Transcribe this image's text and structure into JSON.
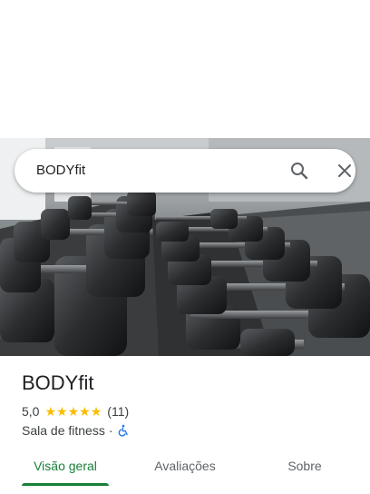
{
  "search": {
    "query": "BODYfit"
  },
  "place": {
    "name": "BODYfit",
    "rating": "5,0",
    "review_count": "(11)",
    "stars": [
      "★",
      "★",
      "★",
      "★",
      "★"
    ],
    "category": "Sala de fitness",
    "separator": "·",
    "wheelchair_icon": "wheelchair-accessible-icon"
  },
  "tabs": [
    {
      "label": "Visão geral",
      "active": true
    },
    {
      "label": "Avaliações",
      "active": false
    },
    {
      "label": "Sobre",
      "active": false
    }
  ],
  "colors": {
    "accent": "#188038",
    "star": "#fbbc04",
    "text": "#202124",
    "secondary_text": "#5f6368"
  }
}
